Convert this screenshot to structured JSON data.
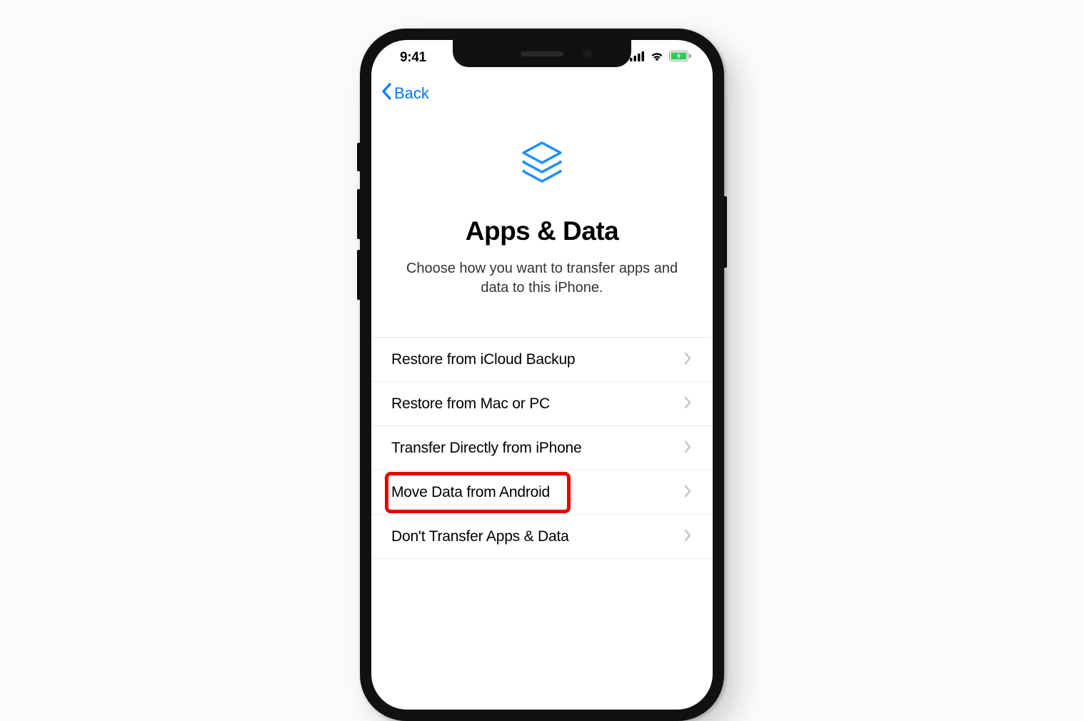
{
  "status": {
    "time": "9:41"
  },
  "nav": {
    "back_label": "Back"
  },
  "page": {
    "title": "Apps & Data",
    "subtitle": "Choose how you want to transfer apps and data to this iPhone."
  },
  "options": [
    {
      "label": "Restore from iCloud Backup",
      "highlighted": false
    },
    {
      "label": "Restore from Mac or PC",
      "highlighted": false
    },
    {
      "label": "Transfer Directly from iPhone",
      "highlighted": false
    },
    {
      "label": "Move Data from Android",
      "highlighted": true
    },
    {
      "label": "Don't Transfer Apps & Data",
      "highlighted": false
    }
  ]
}
